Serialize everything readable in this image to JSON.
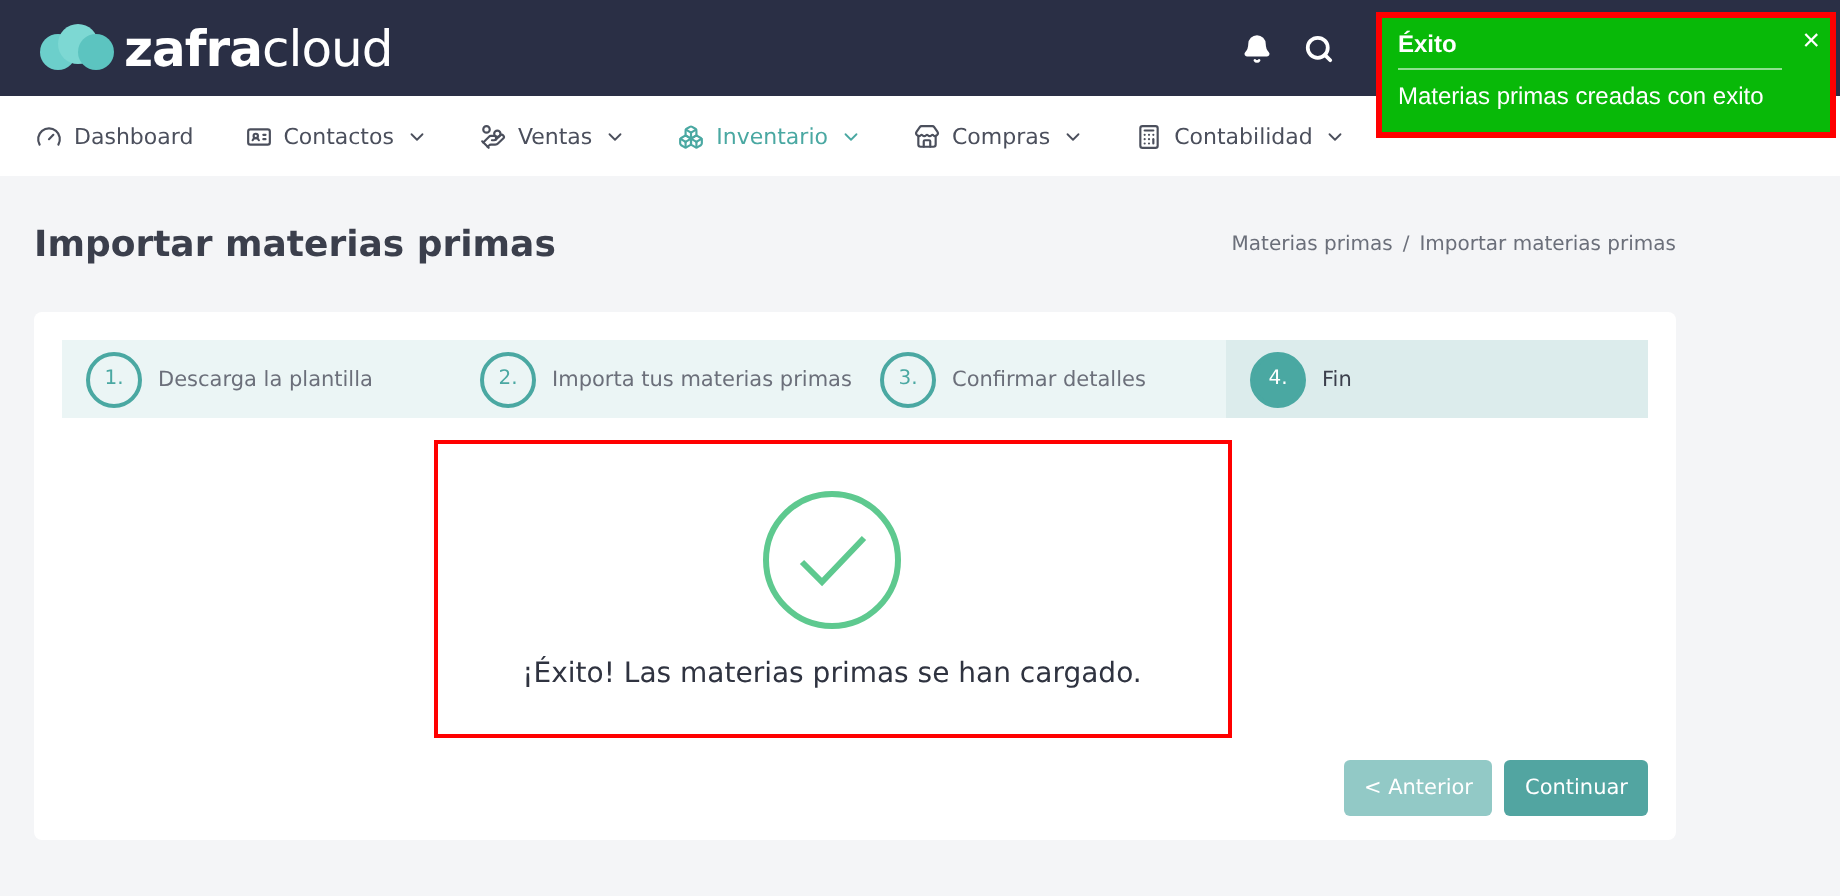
{
  "brand": {
    "part1": "zafra",
    "part2": "cloud"
  },
  "nav": [
    {
      "label": "Dashboard",
      "dropdown": false,
      "selected": false
    },
    {
      "label": "Contactos",
      "dropdown": true,
      "selected": false
    },
    {
      "label": "Ventas",
      "dropdown": true,
      "selected": false
    },
    {
      "label": "Inventario",
      "dropdown": true,
      "selected": true
    },
    {
      "label": "Compras",
      "dropdown": true,
      "selected": false
    },
    {
      "label": "Contabilidad",
      "dropdown": true,
      "selected": false
    }
  ],
  "toast": {
    "title": "Éxito",
    "close": "×",
    "message": "Materias primas creadas con exito"
  },
  "page_title": "Importar materias primas",
  "breadcrumb": {
    "items": [
      "Materias primas",
      "Importar materias primas"
    ],
    "separator": "/"
  },
  "steps": [
    {
      "number": "1.",
      "label": "Descarga la plantilla",
      "selected": false
    },
    {
      "number": "2.",
      "label": "Importa tus materias primas",
      "selected": false
    },
    {
      "number": "3.",
      "label": "Confirmar detalles",
      "selected": false
    },
    {
      "number": "4.",
      "label": "Fin",
      "selected": true
    }
  ],
  "result": {
    "message": "¡Éxito! Las materias primas se han cargado."
  },
  "buttons": [
    {
      "label": "< Anterior",
      "disabled": true
    },
    {
      "label": "Continuar",
      "disabled": false
    }
  ]
}
